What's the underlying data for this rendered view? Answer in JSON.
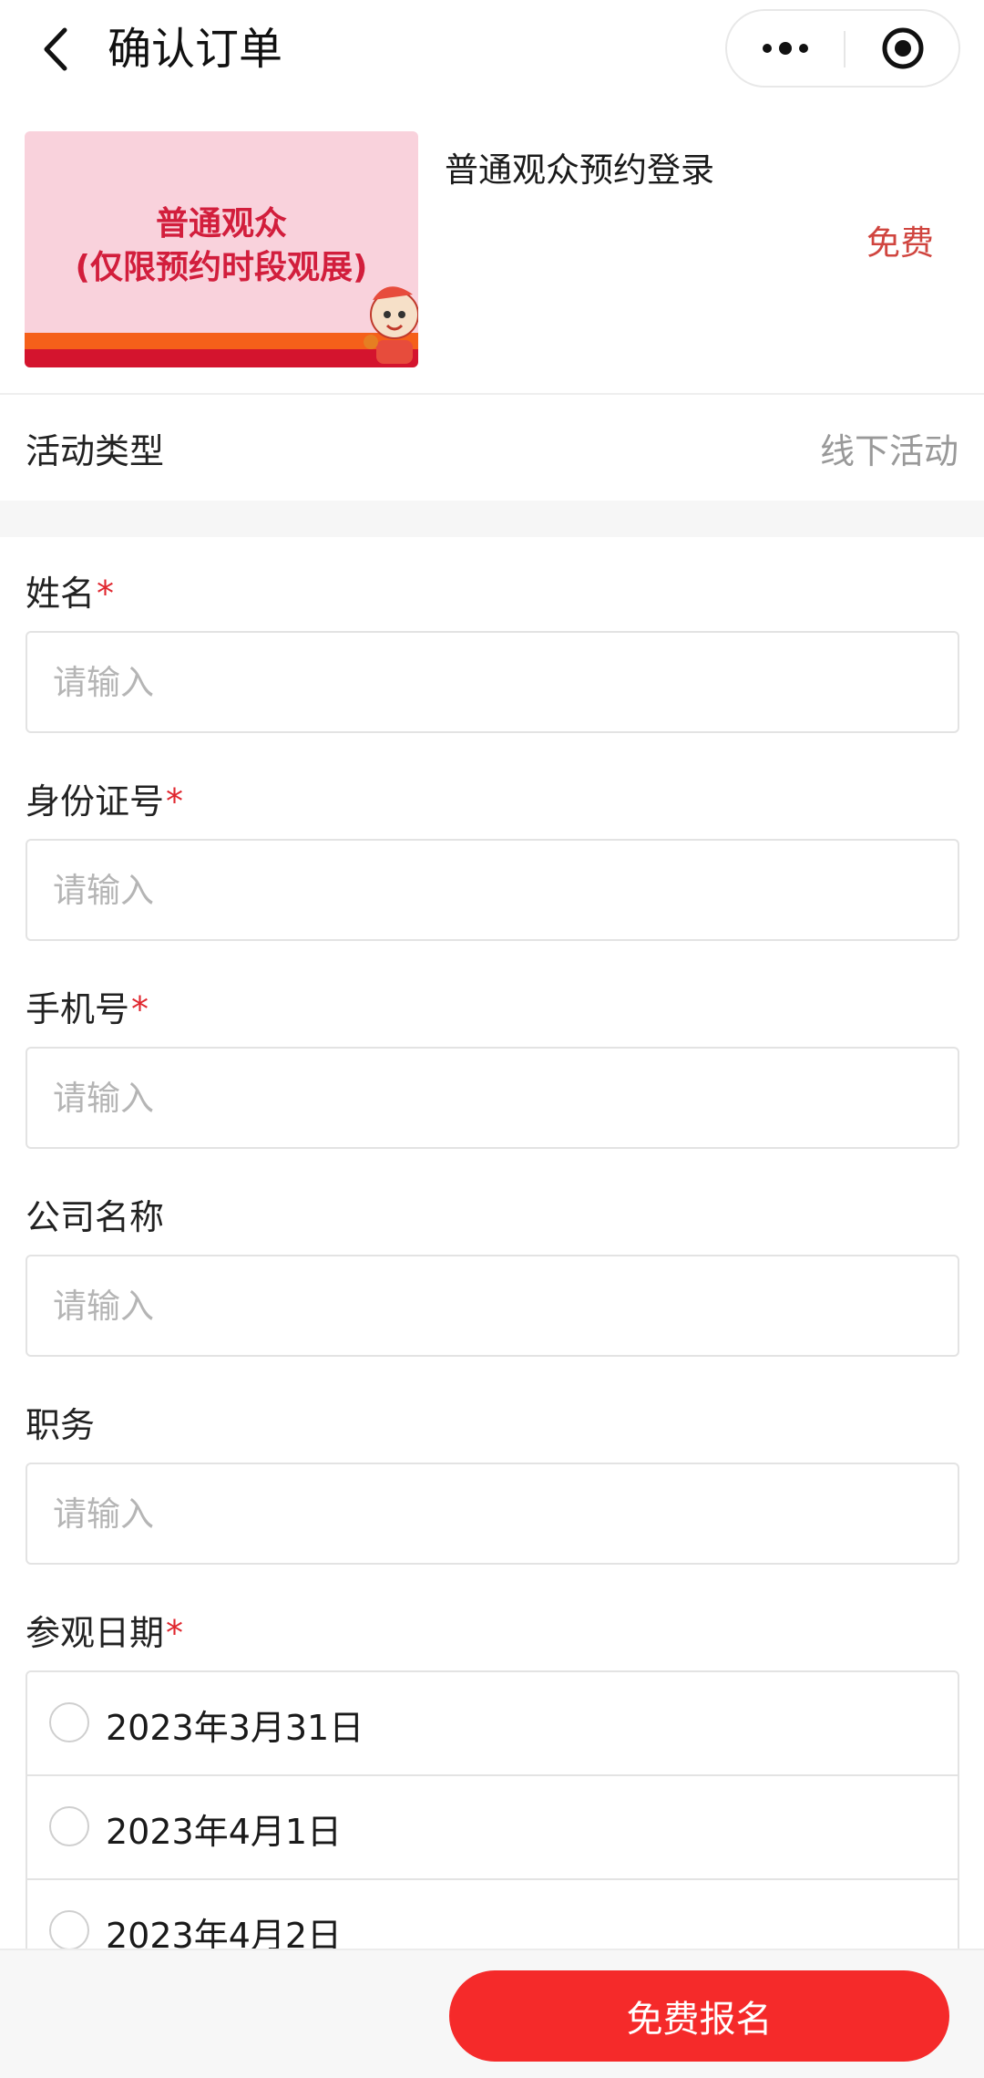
{
  "nav": {
    "title": "确认订单",
    "back_icon": "chevron-left-icon",
    "more_icon": "more-dots-icon",
    "close_icon": "target-circle-icon"
  },
  "product": {
    "banner_line1": "普通观众",
    "banner_line2": "(仅限预约时段观展)",
    "name": "普通观众预约登录",
    "price": "免费"
  },
  "activity": {
    "label": "活动类型",
    "value": "线下活动"
  },
  "form": {
    "required_mark": "*",
    "fields": [
      {
        "label": "姓名",
        "required": true,
        "placeholder": "请输入"
      },
      {
        "label": "身份证号",
        "required": true,
        "placeholder": "请输入"
      },
      {
        "label": "手机号",
        "required": true,
        "placeholder": "请输入"
      },
      {
        "label": "公司名称",
        "required": false,
        "placeholder": "请输入"
      },
      {
        "label": "职务",
        "required": false,
        "placeholder": "请输入"
      }
    ],
    "date_label": "参观日期",
    "date_required": true,
    "dates": [
      "2023年3月31日",
      "2023年4月1日",
      "2023年4月2日"
    ]
  },
  "footer": {
    "submit_label": "免费报名"
  },
  "colors": {
    "accent": "#f52a2a",
    "price": "#d0453f",
    "required": "#e0262e"
  }
}
